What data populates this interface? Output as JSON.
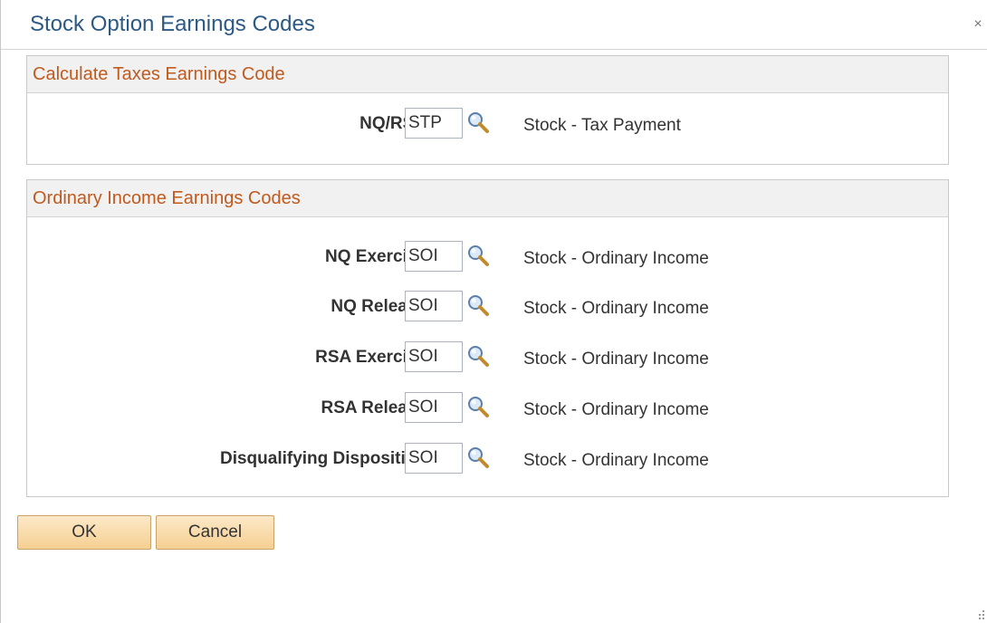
{
  "dialog": {
    "title": "Stock Option Earnings Codes",
    "close_glyph": "×"
  },
  "groups": [
    {
      "title": "Calculate Taxes Earnings Code",
      "rows": [
        {
          "label": "NQ/RSA",
          "code": "STP",
          "description": "Stock - Tax Payment"
        }
      ]
    },
    {
      "title": "Ordinary Income Earnings Codes",
      "rows": [
        {
          "label": "NQ Exercise",
          "code": "SOI",
          "description": "Stock - Ordinary Income"
        },
        {
          "label": "NQ Release",
          "code": "SOI",
          "description": "Stock - Ordinary Income"
        },
        {
          "label": "RSA Exercise",
          "code": "SOI",
          "description": "Stock - Ordinary Income"
        },
        {
          "label": "RSA Release",
          "code": "SOI",
          "description": "Stock - Ordinary Income"
        },
        {
          "label": "Disqualifying Disposition",
          "code": "SOI",
          "description": "Stock - Ordinary Income"
        }
      ]
    }
  ],
  "buttons": {
    "ok": "OK",
    "cancel": "Cancel"
  },
  "icons": {
    "lookup": "magnifier-icon",
    "close": "close-icon",
    "resize": "resize-grip-icon"
  },
  "colors": {
    "title": "#2c5a85",
    "group_title": "#c05a1d",
    "button_fill": "#f6cf92"
  }
}
